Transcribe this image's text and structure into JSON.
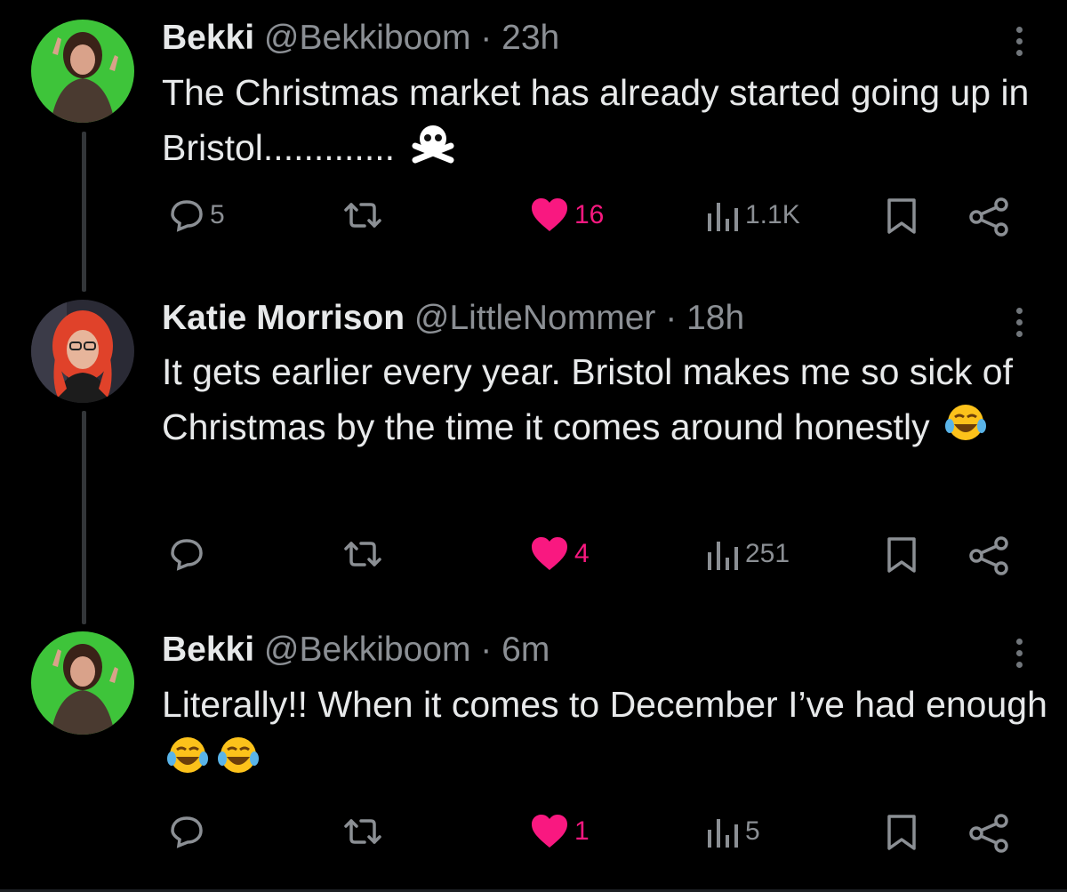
{
  "tweets": [
    {
      "name": "Bekki",
      "handle": "@Bekkiboom",
      "time": "23h",
      "text": "The Christmas market has already started going up in Bristol.............",
      "emoji": "skull-and-crossbones",
      "avatar": "bekki-avatar",
      "replies": "5",
      "likes": "16",
      "views": "1.1K",
      "liked": true
    },
    {
      "name": "Katie Morrison",
      "handle": "@LittleNommer",
      "time": "18h",
      "text": "It gets earlier every year. Bristol makes me so sick of Christmas by the time it comes around honestly",
      "emoji": "face-with-tears-of-joy",
      "avatar": "katie-avatar",
      "replies": "",
      "likes": "4",
      "views": "251",
      "liked": true
    },
    {
      "name": "Bekki",
      "handle": "@Bekkiboom",
      "time": "6m",
      "text": "Literally!! When it comes to December I’ve had enough",
      "emoji": "face-with-tears-of-joy",
      "avatar": "bekki-avatar",
      "replies": "",
      "likes": "1",
      "views": "5",
      "liked": true
    }
  ],
  "colors": {
    "background": "#000000",
    "text": "#e7e9ea",
    "muted": "#8b8f94",
    "like": "#f91880",
    "thread_line": "#333639",
    "avatar_bg_bekki": "#3ec43a"
  }
}
